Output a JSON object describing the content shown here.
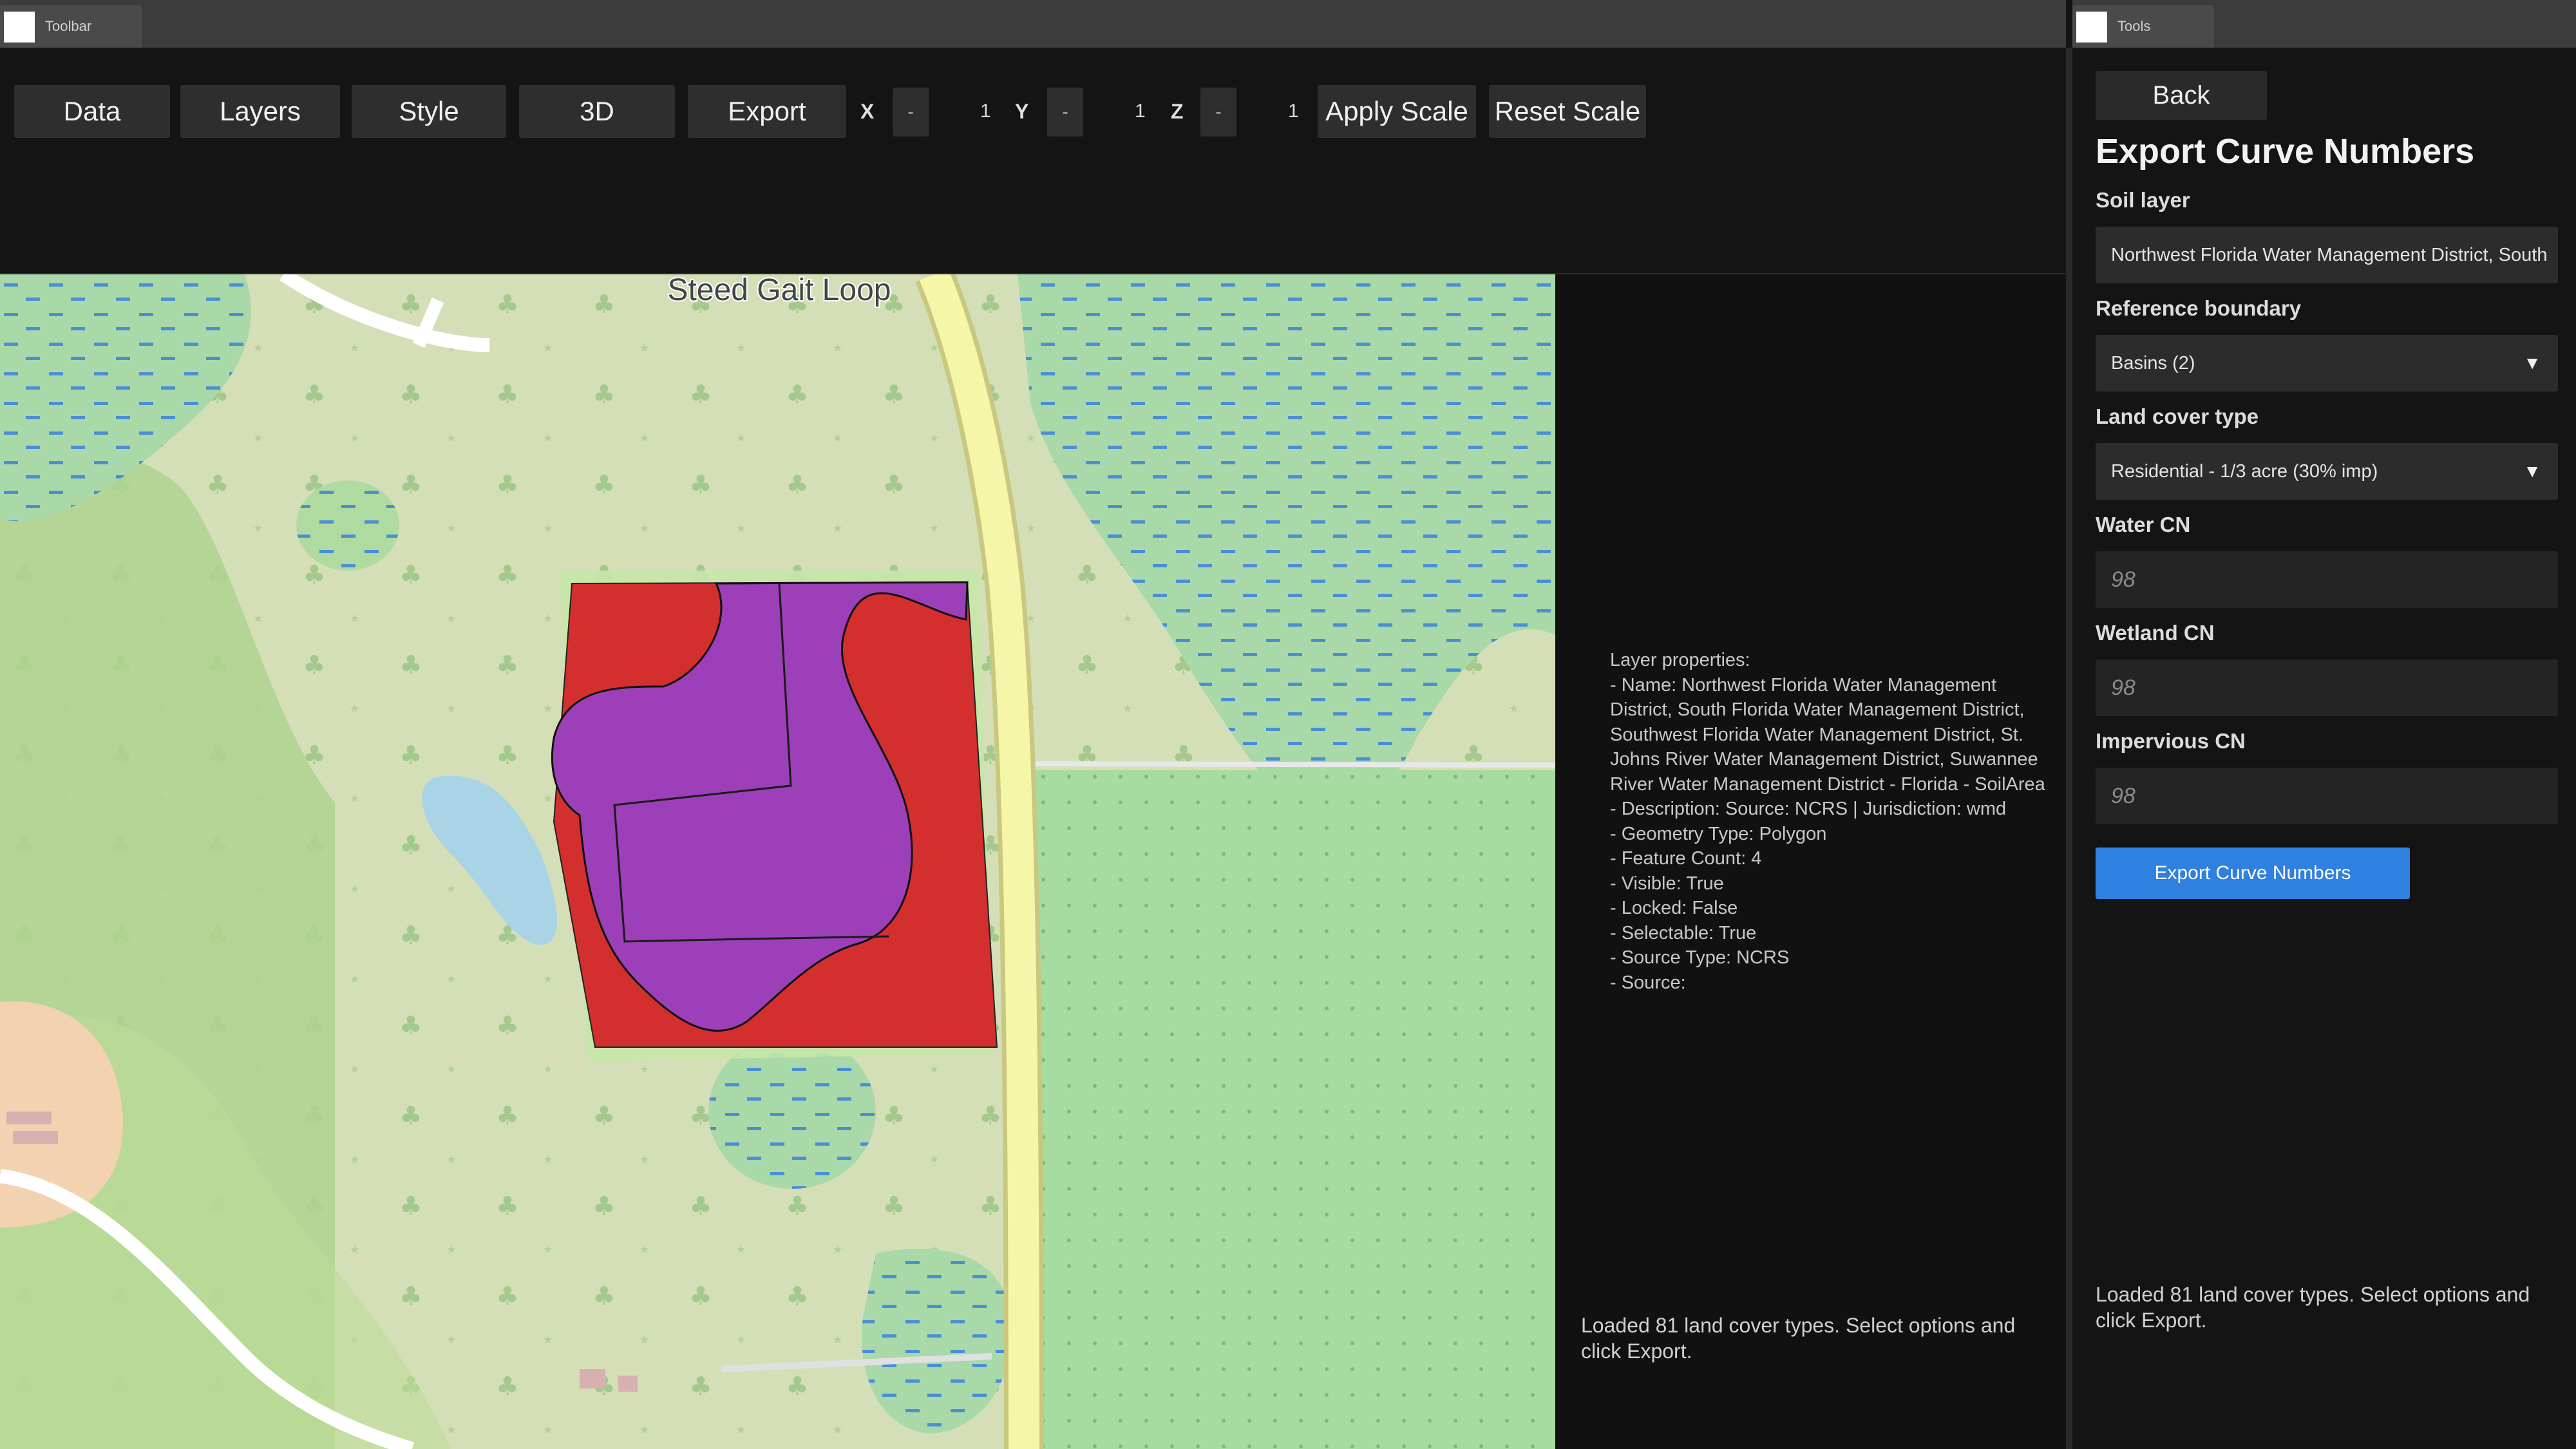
{
  "windows": {
    "left_tab_label": "Toolbar",
    "right_tab_label": "Tools"
  },
  "toolbar": {
    "buttons": [
      "Data",
      "Layers",
      "Style",
      "3D",
      "Export"
    ],
    "x_label": "X",
    "y_label": "Y",
    "z_label": "Z",
    "stepper_glyph": "-",
    "x_value": "1",
    "y_value": "1",
    "z_value": "1",
    "apply_scale": "Apply Scale",
    "reset_scale": "Reset Scale"
  },
  "map": {
    "road_label": "Steed Gait Loop",
    "colors": {
      "land": "#d5dfb8",
      "forest": "#aed48e",
      "wetland": "#a8d6a0",
      "water": "#a8d4e6",
      "road": "#f6f6a8",
      "soil_red": "#d32f2f",
      "soil_purple": "#9c3fb8",
      "farmland": "#a6dca2"
    }
  },
  "properties": {
    "text": "Layer properties:\n- Name: Northwest Florida Water Management District, South Florida Water Management District, Southwest Florida Water Management District, St. Johns River Water Management District, Suwannee River Water Management District - Florida - SoilArea\n- Description: Source: NCRS | Jurisdiction: wmd\n- Geometry Type: Polygon\n- Feature Count: 4\n- Visible: True\n- Locked: False\n- Selectable: True\n- Source Type: NCRS\n- Source:"
  },
  "status_left": "Loaded 81 land cover types. Select options and click Export.",
  "panel": {
    "back_label": "Back",
    "title": "Export Curve Numbers",
    "soil_layer_label": "Soil layer",
    "soil_layer_value": "Northwest Florida Water Management District, South",
    "reference_boundary_label": "Reference boundary",
    "reference_boundary_value": "Basins (2)",
    "land_cover_label": "Land cover type",
    "land_cover_value": "Residential - 1/3 acre (30% imp)",
    "water_cn_label": "Water CN",
    "water_cn_placeholder": "98",
    "wetland_cn_label": "Wetland CN",
    "wetland_cn_placeholder": "98",
    "impervious_cn_label": "Impervious CN",
    "impervious_cn_placeholder": "98",
    "export_button": "Export Curve Numbers",
    "status": "Loaded 81 land cover types. Select options and click Export.",
    "dropdown_arrow": "▼"
  }
}
